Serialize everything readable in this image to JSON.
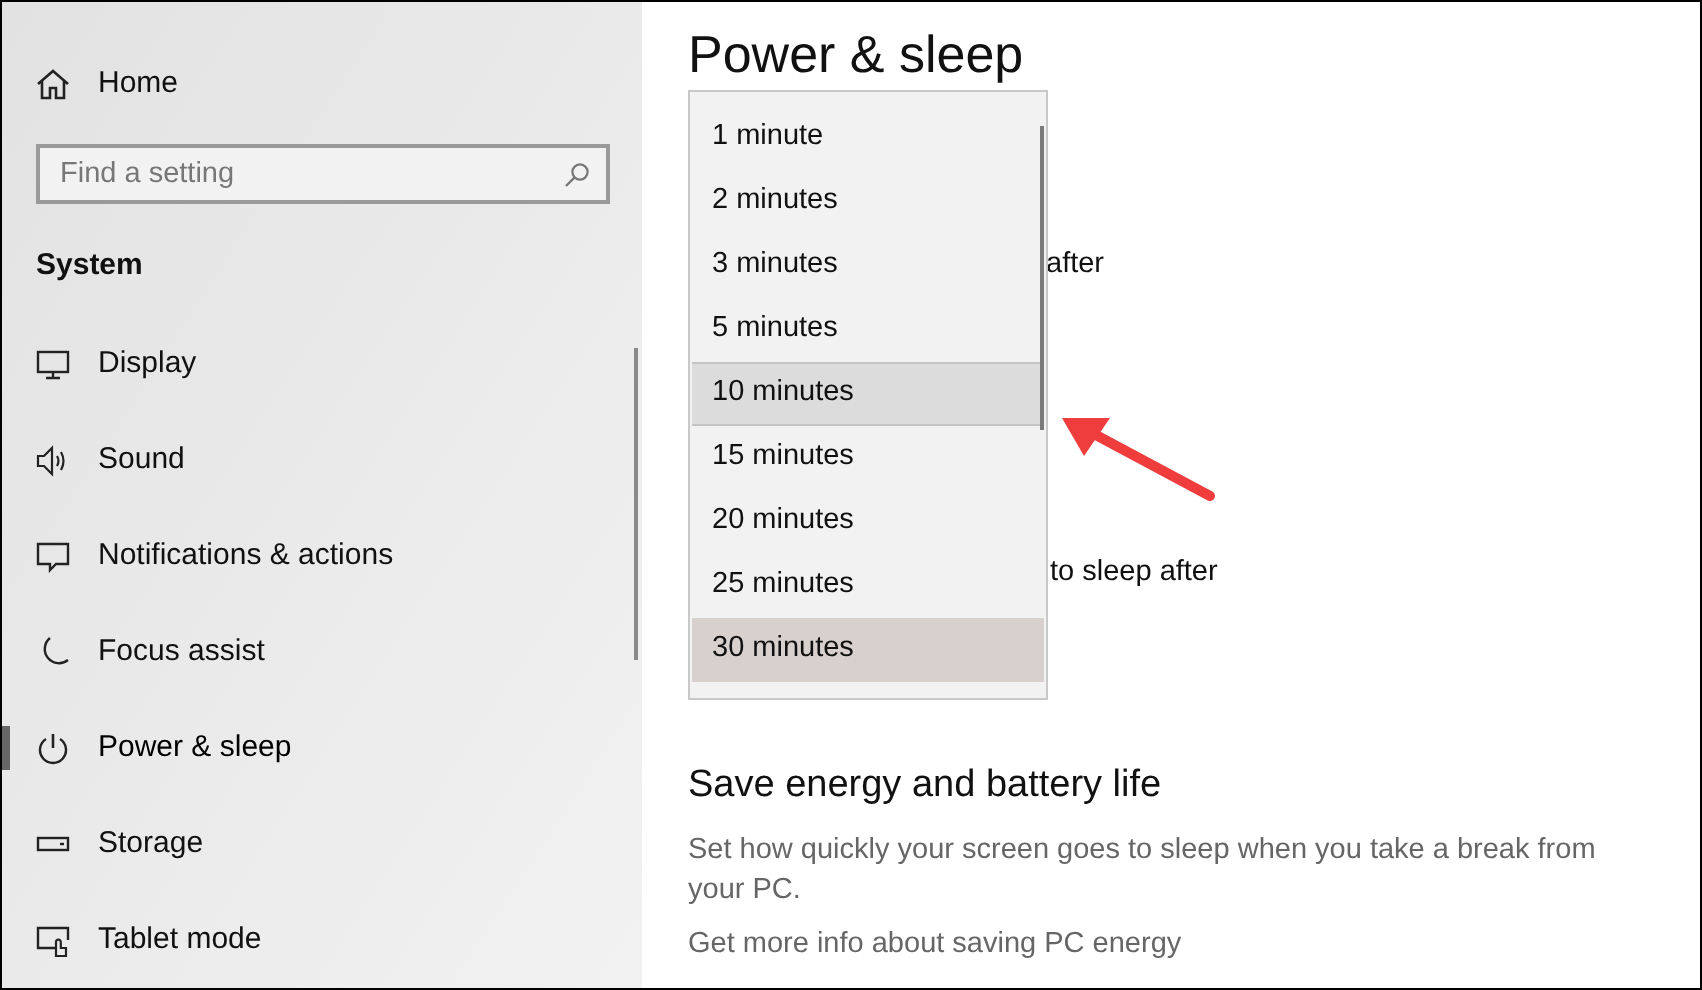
{
  "sidebar": {
    "home": "Home",
    "search": {
      "placeholder": "Find a setting"
    },
    "section": "System",
    "items": [
      {
        "label": "Display",
        "selected": false
      },
      {
        "label": "Sound",
        "selected": false
      },
      {
        "label": "Notifications & actions",
        "selected": false
      },
      {
        "label": "Focus assist",
        "selected": false
      },
      {
        "label": "Power & sleep",
        "selected": true
      },
      {
        "label": "Storage",
        "selected": false
      },
      {
        "label": "Tablet mode",
        "selected": false
      }
    ]
  },
  "main": {
    "title": "Power & sleep",
    "screen_label": "after",
    "sleep_label": "to sleep after",
    "save_heading": "Save energy and battery life",
    "save_text": "Set how quickly your screen goes to sleep when you take a break from your PC.",
    "link": "Get more info about saving PC energy"
  },
  "dropdown": {
    "options": [
      {
        "label": "1 minute",
        "hovered": false,
        "selected": false
      },
      {
        "label": "2 minutes",
        "hovered": false,
        "selected": false
      },
      {
        "label": "3 minutes",
        "hovered": false,
        "selected": false
      },
      {
        "label": "5 minutes",
        "hovered": false,
        "selected": false
      },
      {
        "label": "10 minutes",
        "hovered": true,
        "selected": false
      },
      {
        "label": "15 minutes",
        "hovered": false,
        "selected": false
      },
      {
        "label": "20 minutes",
        "hovered": false,
        "selected": false
      },
      {
        "label": "25 minutes",
        "hovered": false,
        "selected": false
      },
      {
        "label": "30 minutes",
        "hovered": false,
        "selected": true
      }
    ]
  }
}
